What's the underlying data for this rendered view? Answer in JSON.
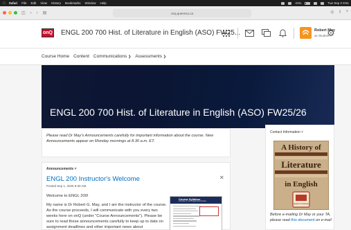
{
  "menubar": {
    "items": [
      "Safari",
      "File",
      "Edit",
      "View",
      "History",
      "Bookmarks",
      "Window",
      "Help"
    ],
    "battery": "41%",
    "clock": "Tue Sep 2 9:51"
  },
  "browser": {
    "url": "onq.queensu.ca"
  },
  "header": {
    "logo": "onQ",
    "course_title": "ENGL 200 700 Hist. of Literature in English (ASO) FW25...",
    "user_name": "Robert May",
    "user_role": "as Student"
  },
  "nav": {
    "items": [
      {
        "label": "Course Home"
      },
      {
        "label": "Content"
      },
      {
        "label": "Communications",
        "dropdown": true
      },
      {
        "label": "Assessments",
        "dropdown": true
      }
    ]
  },
  "banner": {
    "title": "ENGL 200 700 Hist. of Literature in English (ASO) FW25/26"
  },
  "notice": {
    "text": "Please read Dr May's Announcements carefully for important information about the course. New Announcements appear on Monday mornings at 8.30 a.m. ET."
  },
  "announcements": {
    "widget_title": "Announcements",
    "item_title": "ENGL 200 Instructor's Welcome",
    "posted": "Posted Sep 1, 2025 8:30 AM",
    "greeting": "Welcome to ENGL 200!",
    "body": "My name is Dr Robert G. May, and I am the instructor of the course. As the course proceeds, I will communicate with you every two weeks here on onQ (under \"Course Announcements\"). Please be sure to read these announcements carefully to keep up to date on assignment deadlines and other important news about",
    "syllabus_title": "Course Syllabus",
    "syllabus_subtitle": "A Guide to Your Organized Studies"
  },
  "contact": {
    "widget_title": "Contact Information",
    "book_line1": "A History of",
    "book_line2": "Literature",
    "book_line3": "in English",
    "book_badge": "Queen's University",
    "text_before": "Before e-mailing Dr May or your TA, please read ",
    "link": "this document",
    "text_after": " on e-mail"
  },
  "colors": {
    "brand_red": "#c8102e",
    "link_blue": "#006fbf",
    "banner_navy": "#0b1430",
    "avatar_orange": "#f7931e"
  }
}
